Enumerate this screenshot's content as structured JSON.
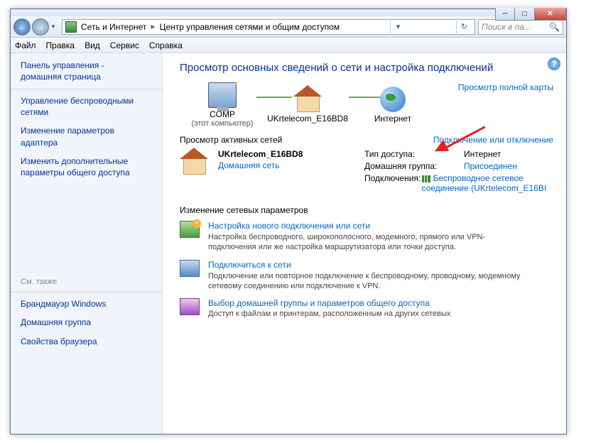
{
  "breadcrumb": {
    "level1": "Сеть и Интернет",
    "level2": "Центр управления сетями и общим доступом"
  },
  "search": {
    "placeholder": "Поиск в па..."
  },
  "menu": {
    "file": "Файл",
    "edit": "Правка",
    "view": "Вид",
    "tools": "Сервис",
    "help": "Справка"
  },
  "sidebar": {
    "home1": "Панель управления -",
    "home2": "домашняя страница",
    "links": [
      "Управление беспроводными сетями",
      "Изменение параметров адаптера",
      "Изменить дополнительные параметры общего доступа"
    ],
    "also_label": "См. также",
    "also": [
      "Брандмауэр Windows",
      "Домашняя группа",
      "Свойства браузера"
    ]
  },
  "main": {
    "heading": "Просмотр основных сведений о сети и настройка подключений",
    "fullmap": "Просмотр полной карты",
    "map": {
      "comp": "COMP",
      "comp_sub": "(этот компьютер)",
      "network": "UKrtelecom_E16BD8",
      "internet": "Интернет"
    },
    "active_heading": "Просмотр активных сетей",
    "connect_toggle": "Подключение или отключение",
    "network": {
      "name": "UKrtelecom_E16BD8",
      "type": "Домашняя сеть",
      "access_label": "Тип доступа:",
      "access_value": "Интернет",
      "homegroup_label": "Домашняя группа:",
      "homegroup_value": "Присоединен",
      "conn_label": "Подключения:",
      "conn_value": "Беспроводное сетевое соединение (UKrtelecom_E16BI"
    },
    "settings_heading": "Изменение сетевых параметров",
    "actions": [
      {
        "title": "Настройка нового подключения или сети",
        "desc": "Настройка беспроводного, широкополосного, модемного, прямого или VPN-подключения или же настройка маршрутизатора или точки доступа."
      },
      {
        "title": "Подключиться к сети",
        "desc": "Подключение или повторное подключение к беспроводному, проводному, модемному сетевому соединению или подключение к VPN."
      },
      {
        "title": "Выбор домашней группы и параметров общего доступа",
        "desc": "Доступ к файлам и принтерам, расположенным на других сетевых"
      }
    ]
  }
}
